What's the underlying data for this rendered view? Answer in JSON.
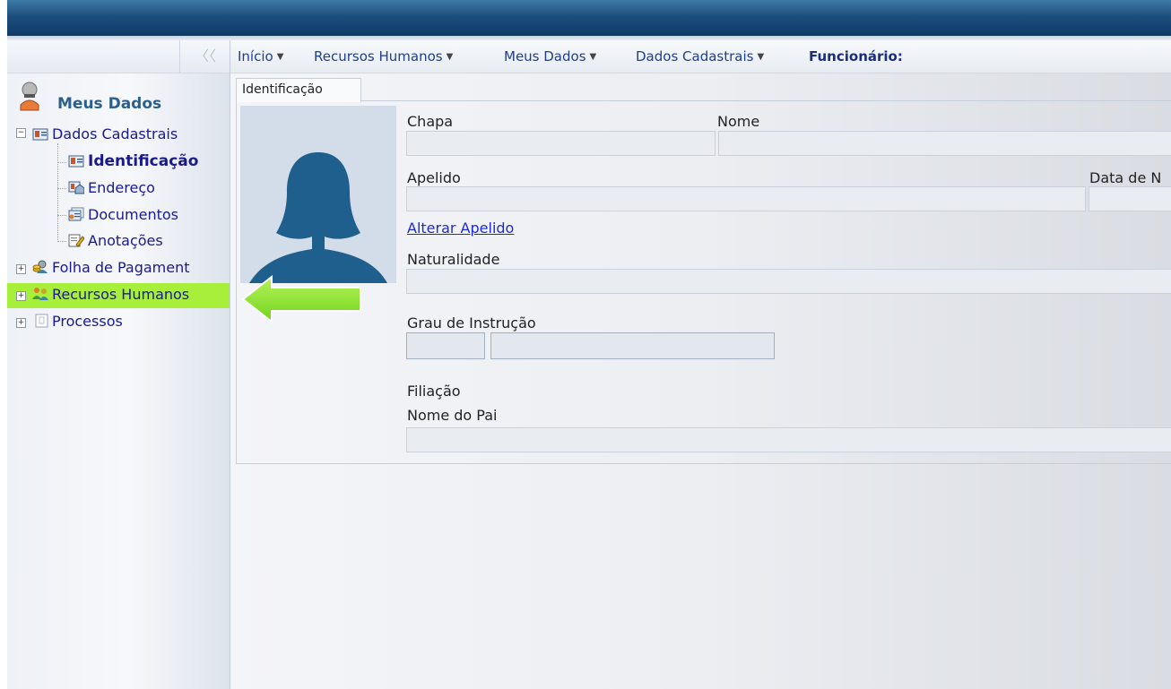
{
  "sidebar": {
    "collapse_label": "〈〈",
    "title": "Meus Dados",
    "items": [
      {
        "label": "Dados Cadastrais",
        "icon": "id-card-icon",
        "expander": "−"
      },
      {
        "label": "Identificação",
        "icon": "id-card-icon"
      },
      {
        "label": "Endereço",
        "icon": "house-card-icon"
      },
      {
        "label": "Documentos",
        "icon": "document-stack-icon"
      },
      {
        "label": "Anotações",
        "icon": "pencil-note-icon"
      },
      {
        "label": "Folha de Pagament",
        "icon": "coins-person-icon",
        "expander": "+"
      },
      {
        "label": "Recursos Humanos",
        "icon": "people-group-icon",
        "expander": "+"
      },
      {
        "label": "Processos",
        "icon": "process-doc-icon",
        "expander": "+"
      }
    ]
  },
  "breadcrumb": {
    "items": [
      "Início",
      "Recursos Humanos",
      "Meus Dados",
      "Dados Cadastrais"
    ],
    "current": "Funcionário:"
  },
  "content": {
    "tab_label": "Identificação",
    "fields": {
      "chapa": "Chapa",
      "nome": "Nome",
      "apelido": "Apelido",
      "data_nasc": "Data de N",
      "alterar_apelido": "Alterar Apelido",
      "naturalidade": "Naturalidade",
      "grau_instrucao": "Grau de Instrução",
      "filiacao": "Filiação",
      "nome_pai": "Nome do Pai"
    }
  },
  "colors": {
    "highlight": "#a7ef3a",
    "arrow": "#8ee834",
    "avatar": "#1f5f8e",
    "link": "#1e2ad6"
  }
}
